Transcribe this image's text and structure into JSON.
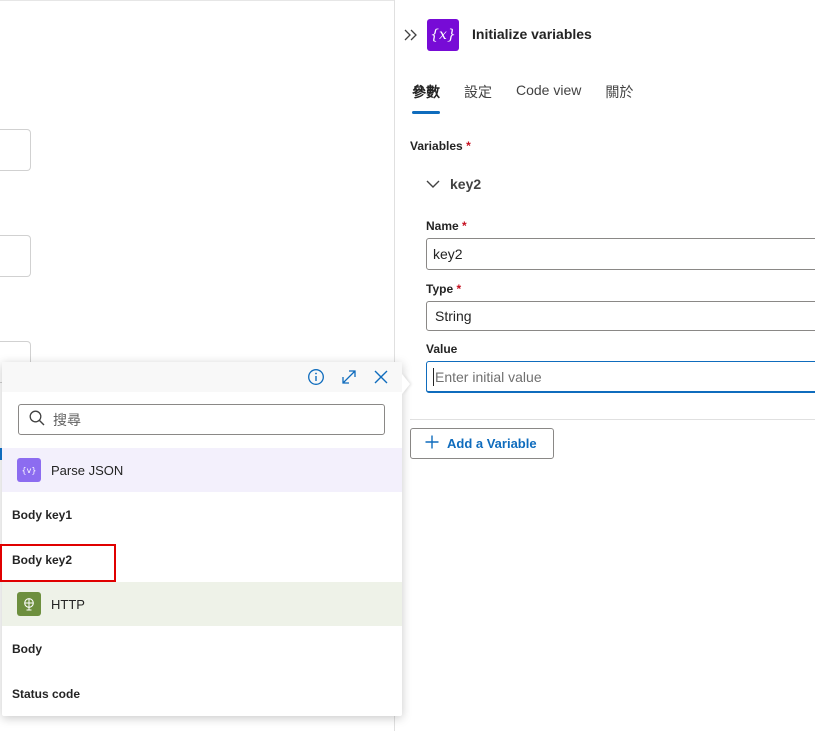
{
  "panel": {
    "title": "Initialize variables",
    "icon_label": "{x}",
    "icon_color": "#770bd6",
    "tabs": [
      {
        "label": "參數",
        "active": true
      },
      {
        "label": "設定",
        "active": false
      },
      {
        "label": "Code view",
        "active": false
      },
      {
        "label": "關於",
        "active": false
      }
    ],
    "variables_label": "Variables",
    "required_mark": "*",
    "variable": {
      "header": "key2",
      "name_label": "Name",
      "name_value": "key2",
      "type_label": "Type",
      "type_value": "String",
      "value_label": "Value",
      "value_placeholder": "Enter initial value"
    },
    "add_button": "Add a Variable"
  },
  "popup": {
    "search_placeholder": "搜尋",
    "groups": [
      {
        "label": "Parse JSON",
        "icon": "parse-json-icon",
        "bg": "#f3f0fc",
        "icon_bg": "#8c6cf0",
        "items": [
          "Body key1",
          "Body key2"
        ]
      },
      {
        "label": "HTTP",
        "icon": "http-globe-icon",
        "bg": "#eef2e8",
        "icon_bg": "#6d8f3e",
        "items": [
          "Body",
          "Status code"
        ]
      }
    ]
  },
  "colors": {
    "accent": "#0f6cbd",
    "highlight_border": "#e00000",
    "required": "#c50f1f"
  }
}
